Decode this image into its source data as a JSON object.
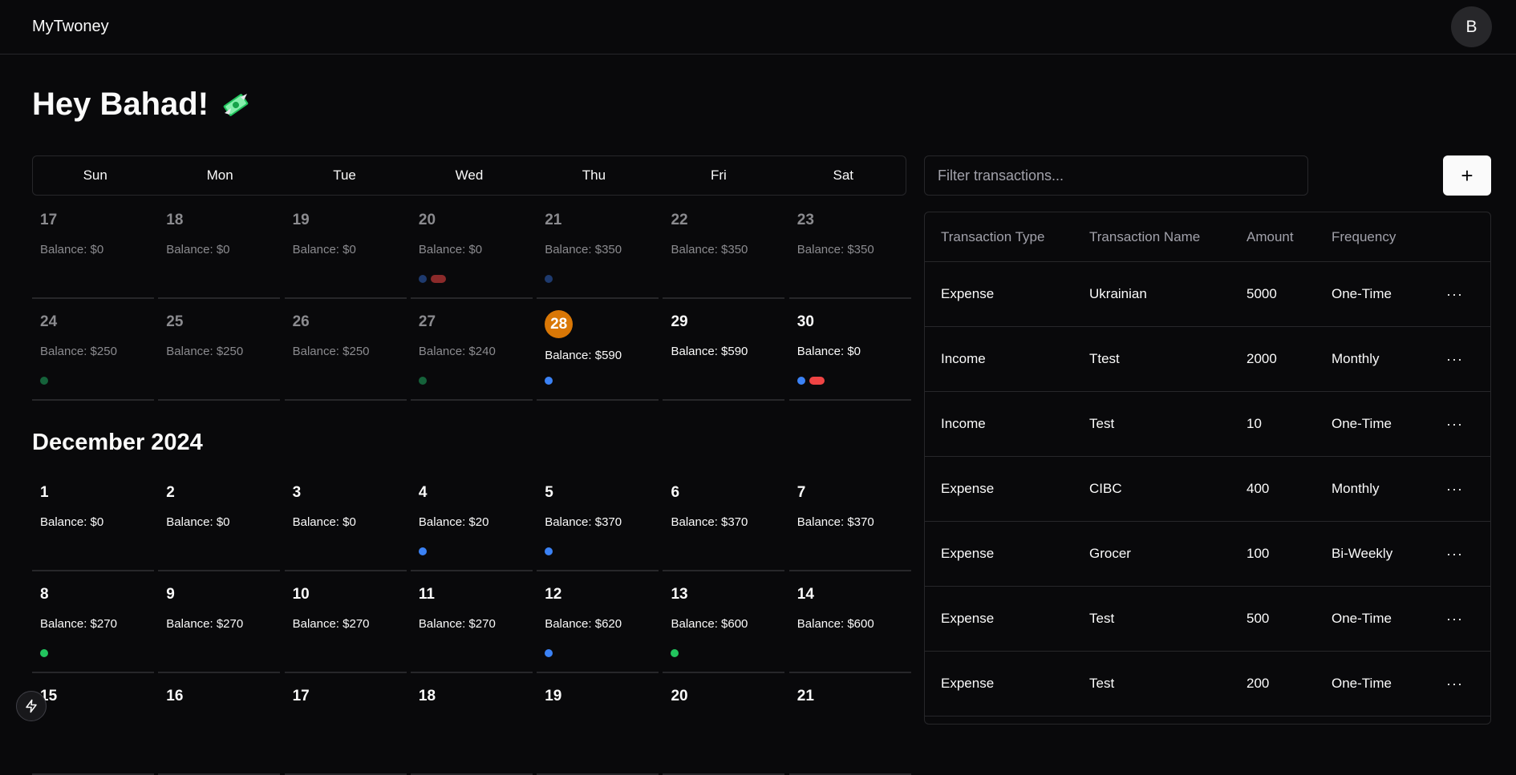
{
  "app": {
    "title": "MyTwoney",
    "avatar_initial": "B"
  },
  "greeting": "Hey Bahad!",
  "calendar": {
    "days_of_week": [
      "Sun",
      "Mon",
      "Tue",
      "Wed",
      "Thu",
      "Fri",
      "Sat"
    ],
    "november_weeks": [
      [
        {
          "day": "17",
          "balance": "Balance: $0",
          "past": true,
          "markers": []
        },
        {
          "day": "18",
          "balance": "Balance: $0",
          "past": true,
          "markers": []
        },
        {
          "day": "19",
          "balance": "Balance: $0",
          "past": true,
          "markers": []
        },
        {
          "day": "20",
          "balance": "Balance: $0",
          "past": true,
          "markers": [
            "blue-dot",
            "red-pill"
          ]
        },
        {
          "day": "21",
          "balance": "Balance: $350",
          "past": true,
          "markers": [
            "blue-dot"
          ]
        },
        {
          "day": "22",
          "balance": "Balance: $350",
          "past": true,
          "markers": []
        },
        {
          "day": "23",
          "balance": "Balance: $350",
          "past": true,
          "markers": []
        }
      ],
      [
        {
          "day": "24",
          "balance": "Balance: $250",
          "past": true,
          "markers": [
            "green-dot"
          ]
        },
        {
          "day": "25",
          "balance": "Balance: $250",
          "past": true,
          "markers": []
        },
        {
          "day": "26",
          "balance": "Balance: $250",
          "past": true,
          "markers": []
        },
        {
          "day": "27",
          "balance": "Balance: $240",
          "past": true,
          "markers": [
            "green-dot"
          ]
        },
        {
          "day": "28",
          "balance": "Balance: $590",
          "today": true,
          "markers": [
            "blue-dot"
          ]
        },
        {
          "day": "29",
          "balance": "Balance: $590",
          "markers": []
        },
        {
          "day": "30",
          "balance": "Balance: $0",
          "markers": [
            "blue-dot",
            "red-pill"
          ]
        }
      ]
    ],
    "month_title": "December 2024",
    "december_weeks": [
      [
        {
          "day": "1",
          "balance": "Balance: $0",
          "markers": []
        },
        {
          "day": "2",
          "balance": "Balance: $0",
          "markers": []
        },
        {
          "day": "3",
          "balance": "Balance: $0",
          "markers": []
        },
        {
          "day": "4",
          "balance": "Balance: $20",
          "markers": [
            "blue-dot"
          ]
        },
        {
          "day": "5",
          "balance": "Balance: $370",
          "markers": [
            "blue-dot"
          ]
        },
        {
          "day": "6",
          "balance": "Balance: $370",
          "markers": []
        },
        {
          "day": "7",
          "balance": "Balance: $370",
          "markers": []
        }
      ],
      [
        {
          "day": "8",
          "balance": "Balance: $270",
          "markers": [
            "green-dot"
          ]
        },
        {
          "day": "9",
          "balance": "Balance: $270",
          "markers": []
        },
        {
          "day": "10",
          "balance": "Balance: $270",
          "markers": []
        },
        {
          "day": "11",
          "balance": "Balance: $270",
          "markers": []
        },
        {
          "day": "12",
          "balance": "Balance: $620",
          "markers": [
            "blue-dot"
          ]
        },
        {
          "day": "13",
          "balance": "Balance: $600",
          "markers": [
            "green-dot"
          ]
        },
        {
          "day": "14",
          "balance": "Balance: $600",
          "markers": []
        }
      ],
      [
        {
          "day": "15",
          "balance": "",
          "markers": []
        },
        {
          "day": "16",
          "balance": "",
          "markers": []
        },
        {
          "day": "17",
          "balance": "",
          "markers": []
        },
        {
          "day": "18",
          "balance": "",
          "markers": []
        },
        {
          "day": "19",
          "balance": "",
          "markers": []
        },
        {
          "day": "20",
          "balance": "",
          "markers": []
        },
        {
          "day": "21",
          "balance": "",
          "markers": []
        }
      ]
    ]
  },
  "transactions": {
    "filter_placeholder": "Filter transactions...",
    "add_button_label": "+",
    "columns": [
      "Transaction Type",
      "Transaction Name",
      "Amount",
      "Frequency"
    ],
    "actions_label": "···",
    "rows": [
      {
        "type": "Expense",
        "name": "Ukrainian",
        "amount": "5000",
        "frequency": "One-Time"
      },
      {
        "type": "Income",
        "name": "Ttest",
        "amount": "2000",
        "frequency": "Monthly"
      },
      {
        "type": "Income",
        "name": "Test",
        "amount": "10",
        "frequency": "One-Time"
      },
      {
        "type": "Expense",
        "name": "CIBC",
        "amount": "400",
        "frequency": "Monthly"
      },
      {
        "type": "Expense",
        "name": "Grocer",
        "amount": "100",
        "frequency": "Bi-Weekly"
      },
      {
        "type": "Expense",
        "name": "Test",
        "amount": "500",
        "frequency": "One-Time"
      },
      {
        "type": "Expense",
        "name": "Test",
        "amount": "200",
        "frequency": "One-Time"
      }
    ]
  },
  "colors": {
    "accent_today": "#d97706",
    "income_marker": "#22c55e",
    "expense_marker": "#3b82f6",
    "bill_marker": "#ef4444"
  },
  "icons": {
    "greeting_icon": "money-with-wings-icon",
    "dev_tools": "lightning-icon"
  }
}
